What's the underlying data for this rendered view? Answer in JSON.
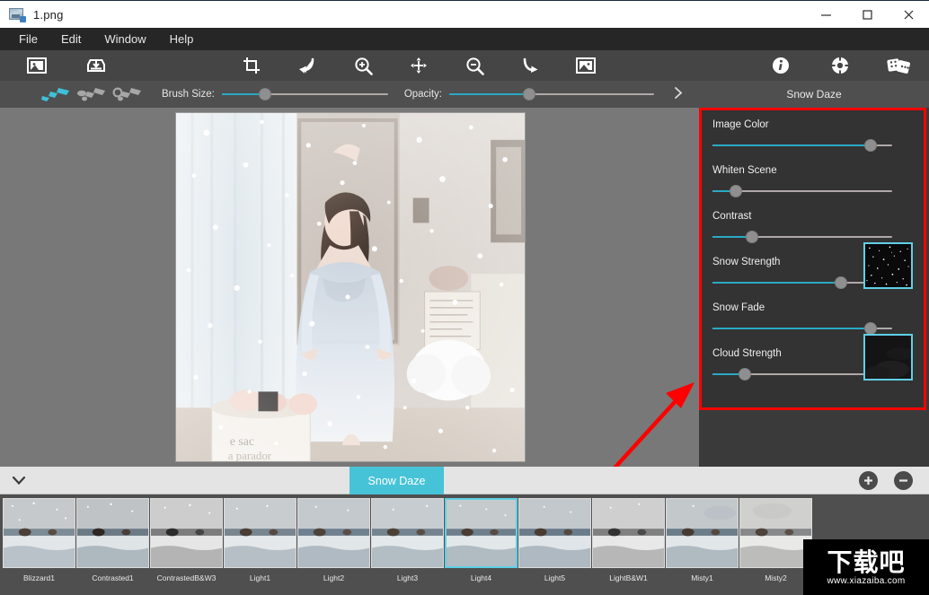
{
  "window": {
    "title": "1.png",
    "app_icon": "image-file-icon",
    "minimize_label": "─",
    "maximize_label": "□",
    "close_label": "✕"
  },
  "menubar": {
    "items": [
      {
        "label": "File"
      },
      {
        "label": "Edit"
      },
      {
        "label": "Window"
      },
      {
        "label": "Help"
      }
    ]
  },
  "toolbar": {
    "left_tools": [
      {
        "name": "open-image-icon",
        "title": "Open Image"
      },
      {
        "name": "save-image-icon",
        "title": "Save Image"
      }
    ],
    "center_tools": [
      {
        "name": "crop-icon",
        "title": "Crop"
      },
      {
        "name": "undo-curve-icon",
        "title": "Undo"
      },
      {
        "name": "zoom-in-icon",
        "title": "Zoom In"
      },
      {
        "name": "pan-move-icon",
        "title": "Pan"
      },
      {
        "name": "zoom-out-icon",
        "title": "Zoom Out"
      },
      {
        "name": "redo-curve-icon",
        "title": "Redo"
      },
      {
        "name": "fit-image-icon",
        "title": "Fit Image"
      }
    ],
    "right_tools": [
      {
        "name": "info-icon",
        "title": "Info"
      },
      {
        "name": "settings-icon",
        "title": "Settings"
      },
      {
        "name": "dice-random-icon",
        "title": "Random"
      }
    ]
  },
  "options_bar": {
    "brush_tools": [
      {
        "name": "brush-paint-icon",
        "active": true
      },
      {
        "name": "brush-erase-icon",
        "active": false
      },
      {
        "name": "brush-smudge-icon",
        "active": false
      }
    ],
    "brush_size": {
      "label": "Brush Size:",
      "value": 26
    },
    "opacity": {
      "label": "Opacity:",
      "value": 39
    },
    "expand_icon": "chevron-right-icon",
    "current_preset": "Snow Daze"
  },
  "settings_panel": {
    "highlight_color": "#ff0000",
    "accent_color": "#2aa9c4",
    "thumb_border_color": "#5fd0e6",
    "sliders": [
      {
        "label": "Image Color",
        "value": 88,
        "has_thumb": false
      },
      {
        "label": "Whiten Scene",
        "value": 13,
        "has_thumb": false
      },
      {
        "label": "Contrast",
        "value": 22,
        "has_thumb": false
      },
      {
        "label": "Snow Strength",
        "value": 84,
        "has_thumb": true,
        "thumb_name": "snow-preview"
      },
      {
        "label": "Snow Fade",
        "value": 88,
        "has_thumb": false
      },
      {
        "label": "Cloud Strength",
        "value": 21,
        "has_thumb": true,
        "thumb_name": "cloud-preview"
      }
    ]
  },
  "preset_bar": {
    "collapse_icon": "chevron-down-icon",
    "active_tab": "Snow Daze",
    "add_label": "+",
    "remove_label": "−"
  },
  "filmstrip": {
    "selected_index": 6,
    "presets": [
      {
        "label": "Blizzard1"
      },
      {
        "label": "Contrasted1"
      },
      {
        "label": "ContrastedB&W3"
      },
      {
        "label": "Light1"
      },
      {
        "label": "Light2"
      },
      {
        "label": "Light3"
      },
      {
        "label": "Light4"
      },
      {
        "label": "Light5"
      },
      {
        "label": "LightB&W1"
      },
      {
        "label": "Misty1"
      },
      {
        "label": "Misty2"
      }
    ]
  },
  "watermark": {
    "text": "下载吧",
    "url": "www.xiazaiba.com"
  },
  "annotation": {
    "arrow_color": "#ff0000",
    "points_to": "settings_panel"
  }
}
